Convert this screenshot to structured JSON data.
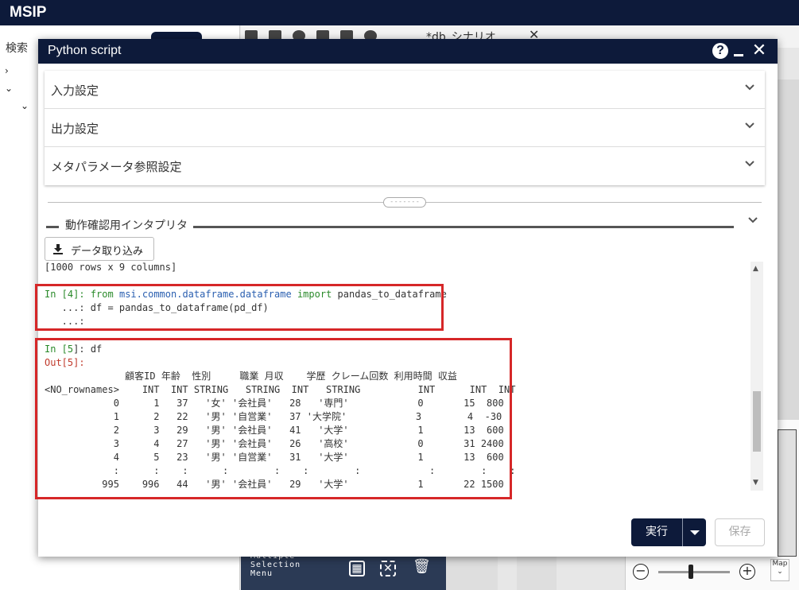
{
  "app": {
    "title": "MSIP",
    "search_label": "検索",
    "tab_label": "*db_シナリオ",
    "tab_close": "✕",
    "multi_selection_menu": "Multiple\nSelection\nMenu",
    "map_label": "Map"
  },
  "modal": {
    "title": "Python script",
    "help": "?",
    "accordion": [
      {
        "label": "入力設定"
      },
      {
        "label": "出力設定"
      },
      {
        "label": "メタパラメータ参照設定"
      }
    ],
    "interpreter_label": "動作確認用インタプリタ",
    "import_button": "データ取り込み",
    "console": {
      "summary": "[1000 rows x 9 columns]",
      "in4_prompt": "In [",
      "in4_num": "4",
      "in4_close": "]: ",
      "in4_kw_from": "from",
      "in4_module": "msi.common.dataframe.dataframe",
      "in4_kw_import": "import",
      "in4_name": "pandas_to_dataframe",
      "in4_cont1": "   ...: df = pandas_to_dataframe(pd_df)",
      "in4_cont2": "   ...:",
      "in5_prompt": "In [",
      "in5_num": "5",
      "in5_close": "]: df",
      "out5": "Out[5]:",
      "table_lines": [
        "              顧客ID 年齢  性別     職業 月収    学歴 クレーム回数 利用時間 収益",
        "<NO_rownames>    INT  INT STRING   STRING  INT   STRING          INT      INT  INT",
        "            0      1   37   '女' '会社員'   28   '専門'            0       15  800",
        "            1      2   22   '男' '自営業'   37 '大学院'            3        4  -30",
        "            2      3   29   '男' '会社員'   41   '大学'            1       13  600",
        "            3      4   27   '男' '会社員'   26   '高校'            0       31 2400",
        "            4      5   23   '男' '自営業'   31   '大学'            1       13  600",
        "            :      :    :      :        :    :        :            :        :    :",
        "          995    996   44   '男' '会社員'   29   '大学'            1       22 1500"
      ]
    },
    "run_button": "実行",
    "save_button": "保存"
  }
}
